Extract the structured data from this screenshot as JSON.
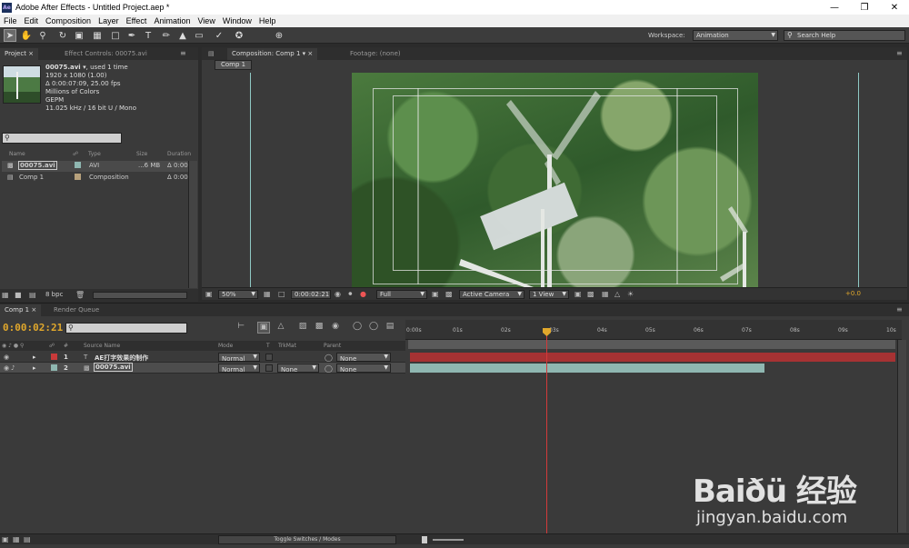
{
  "window": {
    "title": "Adobe After Effects - Untitled Project.aep *",
    "app_icon": "Ae"
  },
  "menu": [
    "File",
    "Edit",
    "Composition",
    "Layer",
    "Effect",
    "Animation",
    "View",
    "Window",
    "Help"
  ],
  "toolbar": {
    "workspace_label": "Workspace:",
    "workspace_value": "Animation",
    "search_help_placeholder": "Search Help"
  },
  "project_panel": {
    "tab_project": "Project",
    "tab_effect_controls": "Effect Controls: 00075.avi",
    "item_name": "00075.avi",
    "item_used": ", used 1 time",
    "meta_lines": [
      "1920 x 1080 (1.00)",
      "Δ 0:00:07:09, 25.00 fps",
      "Millions of Colors",
      "GEPM",
      "11.025 kHz / 16 bit U / Mono"
    ],
    "columns": [
      "Name",
      "Type",
      "Size",
      "Duration"
    ],
    "rows": [
      {
        "name": "00075.avi",
        "type": "AVI",
        "size": "...6 MB",
        "duration": "Δ 0:00",
        "swatch": "#8fb7b1"
      },
      {
        "name": "Comp 1",
        "type": "Composition",
        "size": "",
        "duration": "Δ 0:00",
        "swatch": "#b7a17c"
      }
    ],
    "bpc": "8 bpc"
  },
  "comp_panel": {
    "tab_composition": "Composition: Comp 1",
    "tab_footage": "Footage: (none)",
    "comp_chip": "Comp 1",
    "zoom": "50%",
    "timecode": "0:00:02:21",
    "resolution": "Full",
    "camera": "Active Camera",
    "views": "1 View",
    "exposure": "+0.0"
  },
  "timeline": {
    "tab_comp": "Comp 1",
    "tab_render": "Render Queue",
    "timecode": "0:00:02:21",
    "columns": {
      "num": "#",
      "source": "Source Name",
      "mode": "Mode",
      "t": "T",
      "trkmat": "TrkMat",
      "parent": "Parent"
    },
    "ticks": [
      "0:00s",
      "01s",
      "02s",
      "03s",
      "04s",
      "05s",
      "06s",
      "07s",
      "08s",
      "09s",
      "10s"
    ],
    "current_time_seconds": 2.84,
    "layers": [
      {
        "num": "1",
        "name": "AE打字效果的制作",
        "mode": "Normal",
        "trkmat": "",
        "parent": "None",
        "color": "#a63233"
      },
      {
        "num": "2",
        "name": "00075.avi",
        "mode": "Normal",
        "trkmat": "None",
        "parent": "None",
        "color": "#8fb7b1"
      }
    ],
    "toggle_label": "Toggle Switches / Modes"
  },
  "watermark": {
    "brand": "Baiðü 经验",
    "url": "jingyan.baidu.com"
  }
}
